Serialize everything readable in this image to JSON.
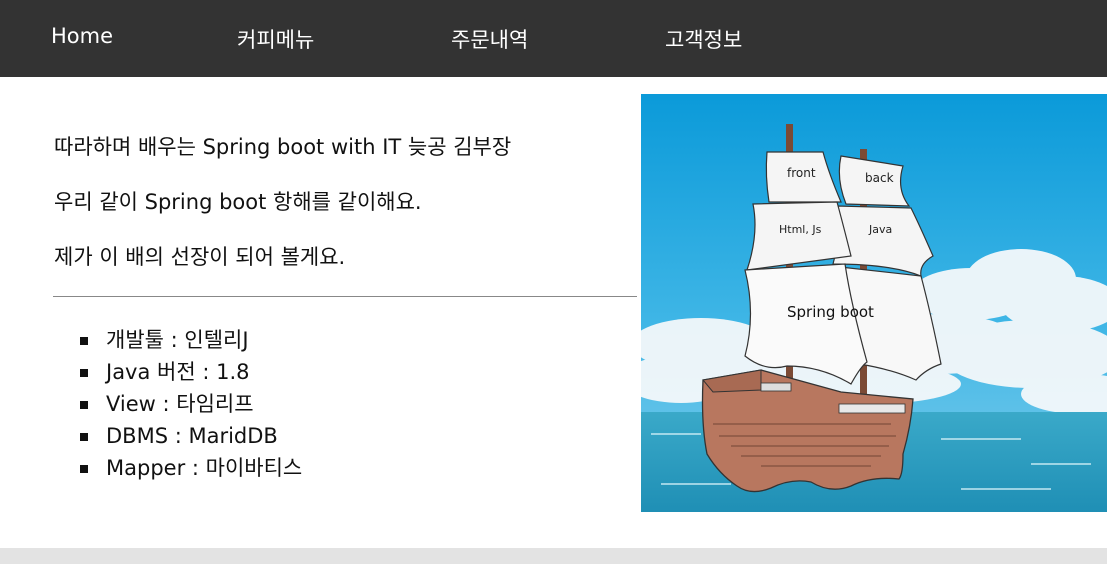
{
  "nav": {
    "items": [
      "Home",
      "커피메뉴",
      "주문내역",
      "고객정보"
    ]
  },
  "intro": [
    "따라하며 배우는 Spring boot with IT 늦공 김부장",
    "우리 같이 Spring boot 항해를 같이해요.",
    "제가 이 배의 선장이 되어 볼게요."
  ],
  "specs": [
    "개발툴 : 인텔리J",
    "Java 버전 : 1.8",
    "View : 타임리프",
    "DBMS : MaridDB",
    "Mapper : 마이바티스"
  ],
  "hero": {
    "sail_labels": {
      "front": "front",
      "back": "back",
      "html_js": "Html, Js",
      "java": "Java",
      "spring_boot": "Spring boot"
    }
  },
  "colors": {
    "nav_bg": "#333333",
    "nav_text": "#ffffff",
    "footer_band": "#e3e3e3",
    "sky_top": "#0e9fdc",
    "sea": "#2aa6c6",
    "hull": "#b8775f"
  }
}
